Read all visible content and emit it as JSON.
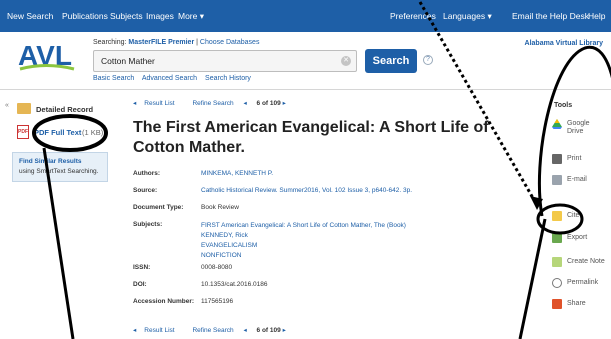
{
  "topnav": {
    "new_search": "New Search",
    "publications": "Publications",
    "subjects": "Subjects",
    "images": "Images",
    "more": "More",
    "preferences": "Preferences",
    "languages": "Languages",
    "email_help": "Email the Help Desk",
    "help": "Help"
  },
  "header": {
    "logo_text": "AVL",
    "searching_label": "Searching:",
    "database": "MasterFILE Premier",
    "choose_databases": "Choose Databases",
    "search_value": "Cotton Mather",
    "search_button": "Search",
    "links": [
      "Basic Search",
      "Advanced Search",
      "Search History"
    ],
    "library": "Alabama Virtual Library"
  },
  "sidebar": {
    "detailed_record": "Detailed Record",
    "pdf_full_text": "PDF Full Text",
    "pdf_size": "(1 KB)",
    "find_similar_title": "Find Similar Results",
    "find_similar_sub": "using SmartText Searching."
  },
  "nav": {
    "result_list": "Result List",
    "refine_search": "Refine Search",
    "position": "6 of 109"
  },
  "record": {
    "title": "The First American Evangelical: A Short Life of Cotton Mather.",
    "fields": {
      "authors_label": "Authors:",
      "authors": "MINKEMA, KENNETH P.",
      "source_label": "Source:",
      "source": "Catholic Historical Review. Summer2016, Vol. 102 Issue 3, p640-642. 3p.",
      "doctype_label": "Document Type:",
      "doctype": "Book Review",
      "subjects_label": "Subjects:",
      "subjects": [
        "FIRST American Evangelical: A Short Life of Cotton Mather, The (Book)",
        "KENNEDY, Rick",
        "EVANGELICALISM",
        "NONFICTION"
      ],
      "issn_label": "ISSN:",
      "issn": "0008-8080",
      "doi_label": "DOI:",
      "doi": "10.1353/cat.2016.0186",
      "accession_label": "Accession Number:",
      "accession": "117565196"
    }
  },
  "tools": {
    "title": "Tools",
    "items": [
      "Google Drive",
      "Print",
      "E-mail",
      "Cite",
      "Export",
      "Create Note",
      "Permalink",
      "Share"
    ]
  },
  "colors": {
    "brand_blue": "#1e5fa7",
    "link_blue": "#1e5fa7"
  }
}
